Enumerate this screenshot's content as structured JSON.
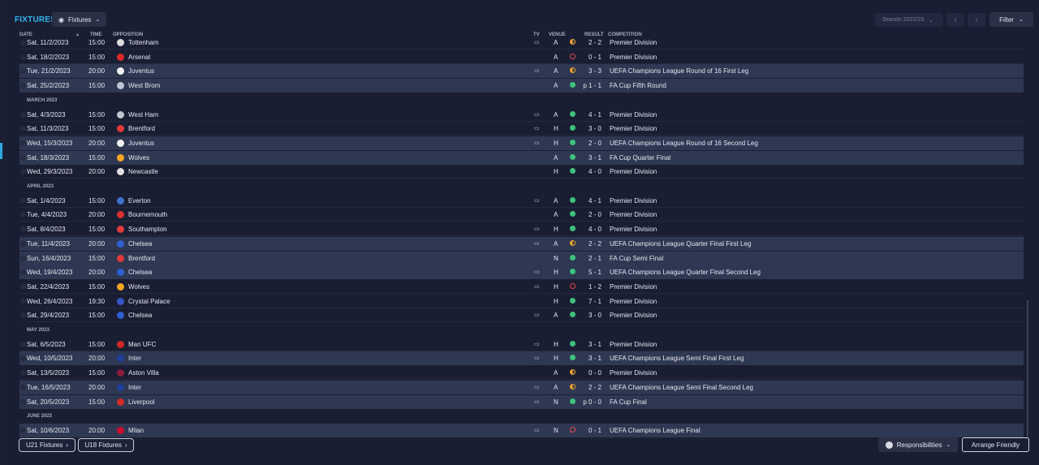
{
  "title": "FIXTURES",
  "view_button": {
    "label": "Fixtures",
    "icon": "eye-icon"
  },
  "season": "Season 2022/23",
  "filter_label": "Filter",
  "columns": {
    "date": "DATE",
    "time": "TIME",
    "opposition": "OPPOSITION",
    "tv": "TV",
    "venue": "VENUE",
    "result": "RESULT",
    "competition": "COMPETITION"
  },
  "rows": [
    {
      "kind": "fixture",
      "date": "Sat, 11/2/2023",
      "time": "15:00",
      "opp": "Tottenham",
      "tv": true,
      "venue": "A",
      "outcome": "draw",
      "score": "2 - 2",
      "comp": "Premier Division",
      "hl": false,
      "badge": "#dcdcdc"
    },
    {
      "kind": "fixture",
      "date": "Sat, 18/2/2023",
      "time": "15:00",
      "opp": "Arsenal",
      "tv": false,
      "venue": "A",
      "outcome": "loss",
      "score": "0 - 1",
      "comp": "Premier Division",
      "hl": false,
      "badge": "#db2a2a"
    },
    {
      "kind": "fixture",
      "date": "Tue, 21/2/2023",
      "time": "20:00",
      "opp": "Juventus",
      "tv": true,
      "venue": "A",
      "outcome": "draw",
      "score": "3 - 3",
      "comp": "UEFA Champions League Round of 16  First Leg",
      "hl": true,
      "badge": "#f2f2f2"
    },
    {
      "kind": "fixture",
      "date": "Sat, 25/2/2023",
      "time": "15:00",
      "opp": "West Brom",
      "tv": false,
      "venue": "A",
      "outcome": "win",
      "score": "p 1 - 1",
      "comp": "FA Cup Fifth Round",
      "hl": true,
      "badge": "#bfc4d4"
    },
    {
      "kind": "month",
      "label": "MARCH 2023"
    },
    {
      "kind": "fixture",
      "date": "Sat, 4/3/2023",
      "time": "15:00",
      "opp": "West Ham",
      "tv": true,
      "venue": "A",
      "outcome": "win",
      "score": "4 - 1",
      "comp": "Premier Division",
      "hl": false,
      "badge": "#c0c4cf"
    },
    {
      "kind": "fixture",
      "date": "Sat, 11/3/2023",
      "time": "15:00",
      "opp": "Brentford",
      "tv": true,
      "venue": "H",
      "outcome": "win",
      "score": "3 - 0",
      "comp": "Premier Division",
      "hl": false,
      "badge": "#e03a3a"
    },
    {
      "kind": "fixture",
      "date": "Wed, 15/3/2023",
      "time": "20:00",
      "opp": "Juventus",
      "tv": true,
      "venue": "H",
      "outcome": "win",
      "score": "2 - 0",
      "comp": "UEFA Champions League Round of 16  Second Leg",
      "hl": true,
      "badge": "#f2f2f2"
    },
    {
      "kind": "fixture",
      "date": "Sat, 18/3/2023",
      "time": "15:00",
      "opp": "Wolves",
      "tv": false,
      "venue": "A",
      "outcome": "win",
      "score": "3 - 1",
      "comp": "FA Cup Quarter Final",
      "hl": true,
      "badge": "#f5a623"
    },
    {
      "kind": "fixture",
      "date": "Wed, 29/3/2023",
      "time": "20:00",
      "opp": "Newcastle",
      "tv": false,
      "venue": "H",
      "outcome": "win",
      "score": "4 - 0",
      "comp": "Premier Division",
      "hl": false,
      "badge": "#e0e0e0"
    },
    {
      "kind": "month",
      "label": "APRIL 2023"
    },
    {
      "kind": "fixture",
      "date": "Sat, 1/4/2023",
      "time": "15:00",
      "opp": "Everton",
      "tv": true,
      "venue": "A",
      "outcome": "win",
      "score": "4 - 1",
      "comp": "Premier Division",
      "hl": false,
      "badge": "#3f73d0"
    },
    {
      "kind": "fixture",
      "date": "Tue, 4/4/2023",
      "time": "20:00",
      "opp": "Bournemouth",
      "tv": false,
      "venue": "A",
      "outcome": "win",
      "score": "2 - 0",
      "comp": "Premier Division",
      "hl": false,
      "badge": "#d93030"
    },
    {
      "kind": "fixture",
      "date": "Sat, 8/4/2023",
      "time": "15:00",
      "opp": "Southampton",
      "tv": true,
      "venue": "H",
      "outcome": "win",
      "score": "4 - 0",
      "comp": "Premier Division",
      "hl": false,
      "badge": "#e33b3b"
    },
    {
      "kind": "fixture",
      "date": "Tue, 11/4/2023",
      "time": "20:00",
      "opp": "Chelsea",
      "tv": true,
      "venue": "A",
      "outcome": "draw",
      "score": "2 - 2",
      "comp": "UEFA Champions League Quarter Final First Leg",
      "hl": true,
      "badge": "#2f5fd0"
    },
    {
      "kind": "fixture",
      "date": "Sun, 16/4/2023",
      "time": "15:00",
      "opp": "Brentford",
      "tv": false,
      "venue": "N",
      "outcome": "win",
      "score": "2 - 1",
      "comp": "FA Cup Semi Final",
      "hl": true,
      "badge": "#e03a3a"
    },
    {
      "kind": "fixture",
      "date": "Wed, 19/4/2023",
      "time": "20:00",
      "opp": "Chelsea",
      "tv": true,
      "venue": "H",
      "outcome": "win",
      "score": "5 - 1",
      "comp": "UEFA Champions League Quarter Final Second Leg",
      "hl": true,
      "badge": "#2f5fd0"
    },
    {
      "kind": "fixture",
      "date": "Sat, 22/4/2023",
      "time": "15:00",
      "opp": "Wolves",
      "tv": true,
      "venue": "H",
      "outcome": "loss",
      "score": "1 - 2",
      "comp": "Premier Division",
      "hl": false,
      "badge": "#f5a623"
    },
    {
      "kind": "fixture",
      "date": "Wed, 26/4/2023",
      "time": "19:30",
      "opp": "Crystal Palace",
      "tv": false,
      "venue": "H",
      "outcome": "win",
      "score": "7 - 1",
      "comp": "Premier Division",
      "hl": false,
      "badge": "#3556c8"
    },
    {
      "kind": "fixture",
      "date": "Sat, 29/4/2023",
      "time": "15:00",
      "opp": "Chelsea",
      "tv": true,
      "venue": "A",
      "outcome": "win",
      "score": "3 - 0",
      "comp": "Premier Division",
      "hl": false,
      "badge": "#2f5fd0"
    },
    {
      "kind": "month",
      "label": "MAY 2023"
    },
    {
      "kind": "fixture",
      "date": "Sat, 6/5/2023",
      "time": "15:00",
      "opp": "Man UFC",
      "tv": true,
      "venue": "H",
      "outcome": "win",
      "score": "3 - 1",
      "comp": "Premier Division",
      "hl": false,
      "badge": "#d02828"
    },
    {
      "kind": "fixture",
      "date": "Wed, 10/5/2023",
      "time": "20:00",
      "opp": "Inter",
      "tv": true,
      "venue": "H",
      "outcome": "win",
      "score": "3 - 1",
      "comp": "UEFA Champions League Semi Final First Leg",
      "hl": true,
      "badge": "#1f3f9a"
    },
    {
      "kind": "fixture",
      "date": "Sat, 13/5/2023",
      "time": "15:00",
      "opp": "Aston Villa",
      "tv": false,
      "venue": "A",
      "outcome": "draw",
      "score": "0 - 0",
      "comp": "Premier Division",
      "hl": false,
      "badge": "#8a1c3d"
    },
    {
      "kind": "fixture",
      "date": "Tue, 16/5/2023",
      "time": "20:00",
      "opp": "Inter",
      "tv": true,
      "venue": "A",
      "outcome": "draw",
      "score": "2 - 2",
      "comp": "UEFA Champions League Semi Final Second Leg",
      "hl": true,
      "badge": "#1f3f9a"
    },
    {
      "kind": "fixture",
      "date": "Sat, 20/5/2023",
      "time": "15:00",
      "opp": "Liverpool",
      "tv": true,
      "venue": "N",
      "outcome": "win",
      "score": "p 0 - 0",
      "comp": "FA Cup Final",
      "hl": true,
      "badge": "#d42a2a"
    },
    {
      "kind": "month",
      "label": "JUNE 2023"
    },
    {
      "kind": "fixture",
      "date": "Sat, 10/6/2023",
      "time": "20:00",
      "opp": "Milan",
      "tv": true,
      "venue": "N",
      "outcome": "loss",
      "score": "0 - 1",
      "comp": "UEFA Champions League Final",
      "hl": true,
      "badge": "#c8102e"
    }
  ],
  "footer": {
    "u21": "U21 Fixtures",
    "u18": "U18 Fixtures",
    "responsibilities": "Responsibilities",
    "arrange": "Arrange Friendly"
  }
}
